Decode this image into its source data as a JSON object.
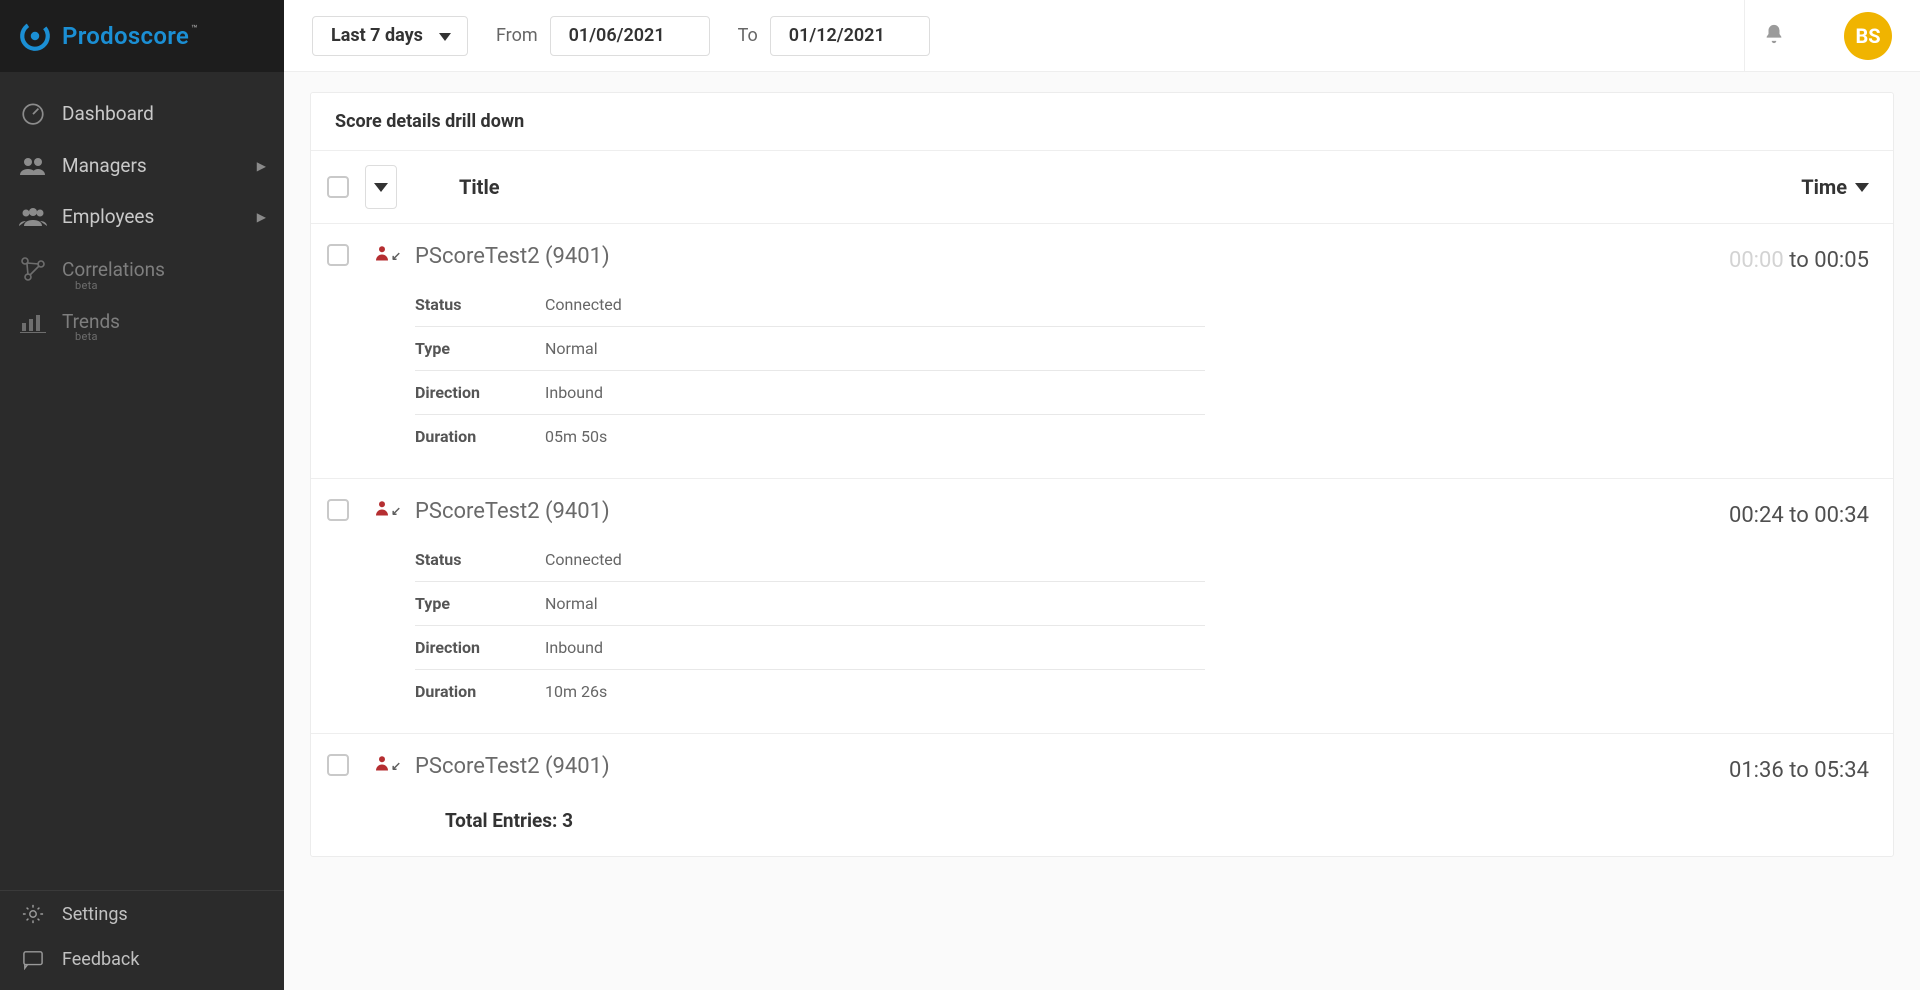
{
  "brand": {
    "name": "Prodoscore",
    "tm": "™"
  },
  "sidebar": {
    "items": [
      {
        "label": "Dashboard",
        "icon": "gauge",
        "chevron": false,
        "beta": false
      },
      {
        "label": "Managers",
        "icon": "people2",
        "chevron": true,
        "beta": false
      },
      {
        "label": "Employees",
        "icon": "people3",
        "chevron": true,
        "beta": false
      },
      {
        "label": "Correlations",
        "icon": "nodes",
        "chevron": false,
        "beta": true
      },
      {
        "label": "Trends",
        "icon": "bars",
        "chevron": false,
        "beta": true
      }
    ],
    "beta_label": "beta",
    "bottom": [
      {
        "label": "Settings",
        "icon": "gear"
      },
      {
        "label": "Feedback",
        "icon": "chat"
      }
    ]
  },
  "topbar": {
    "range_label": "Last 7 days",
    "from_label": "From",
    "to_label": "To",
    "from_value": "01/06/2021",
    "to_value": "01/12/2021",
    "avatar_initials": "BS"
  },
  "panel": {
    "title": "Score details drill down",
    "columns": {
      "title": "Title",
      "time": "Time"
    },
    "detail_labels": {
      "status": "Status",
      "type": "Type",
      "direction": "Direction",
      "duration": "Duration"
    },
    "rows": [
      {
        "title": "PScoreTest2 (9401)",
        "time_from": "00:00",
        "time_from_faded": true,
        "time_to": "00:05",
        "status": "Connected",
        "type": "Normal",
        "direction": "Inbound",
        "duration": "05m 50s",
        "expanded": true
      },
      {
        "title": "PScoreTest2 (9401)",
        "time_from": "00:24",
        "time_from_faded": false,
        "time_to": "00:34",
        "status": "Connected",
        "type": "Normal",
        "direction": "Inbound",
        "duration": "10m 26s",
        "expanded": true
      },
      {
        "title": "PScoreTest2 (9401)",
        "time_from": "01:36",
        "time_from_faded": false,
        "time_to": "05:34",
        "expanded": false
      }
    ],
    "time_sep": " to ",
    "total_label": "Total Entries: 3"
  }
}
